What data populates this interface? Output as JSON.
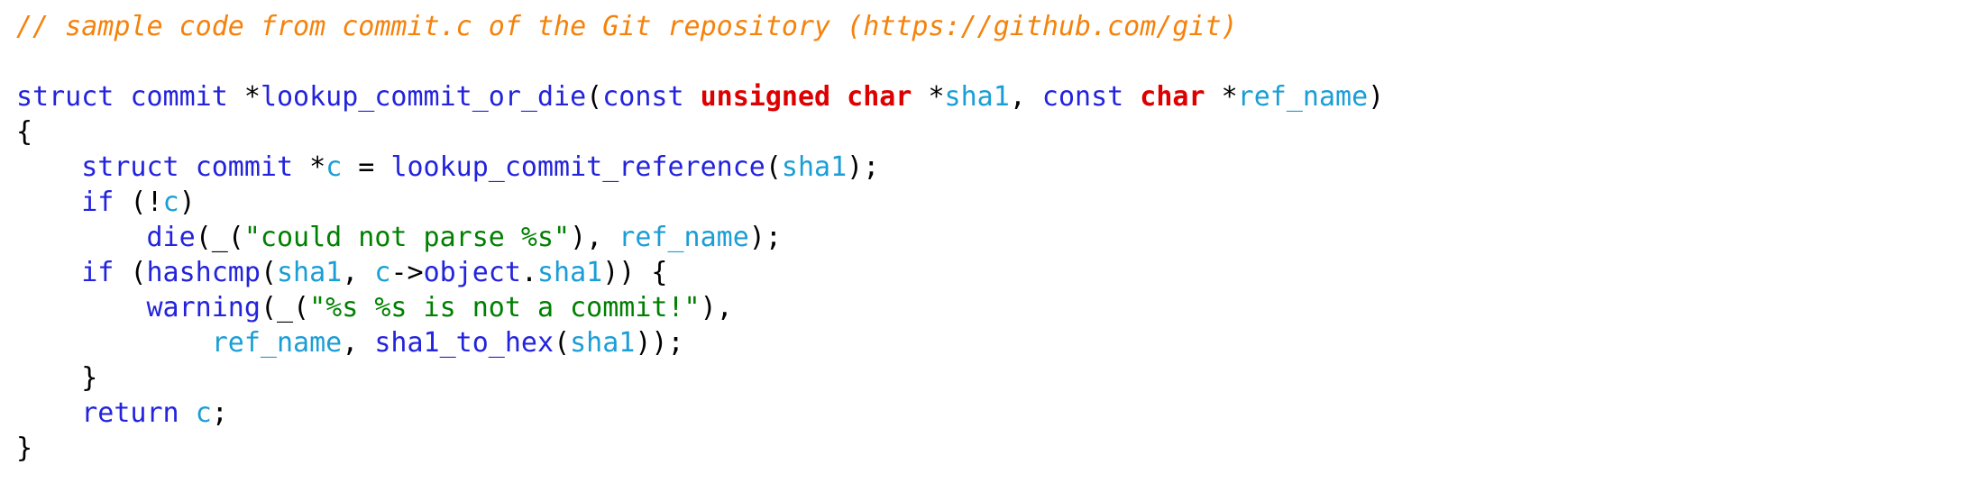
{
  "editor": {
    "language": "c",
    "background": "#ffffff",
    "font_size_px": 30,
    "colors": {
      "comment": "#f5820b",
      "keyword": "#2323dd",
      "function": "#2323dd",
      "type": "#dd0000",
      "variable": "#1a9ed6",
      "string": "#008000",
      "punctuation": "#000000"
    }
  },
  "code": {
    "lines": [
      {
        "id": "line-1-comment",
        "tokens": [
          {
            "text": "// sample code from commit.c of the Git repository (https://github.com/git)",
            "kind": "comment"
          }
        ]
      },
      {
        "id": "line-2-blank",
        "tokens": [
          {
            "text": " ",
            "kind": "plain"
          }
        ]
      },
      {
        "id": "line-3-signature",
        "tokens": [
          {
            "text": "struct",
            "kind": "keyword"
          },
          {
            "text": " ",
            "kind": "plain"
          },
          {
            "text": "commit",
            "kind": "keyword"
          },
          {
            "text": " *",
            "kind": "punctuation"
          },
          {
            "text": "lookup_commit_or_die",
            "kind": "function"
          },
          {
            "text": "(",
            "kind": "punctuation"
          },
          {
            "text": "const",
            "kind": "keyword"
          },
          {
            "text": " ",
            "kind": "plain"
          },
          {
            "text": "unsigned char",
            "kind": "type"
          },
          {
            "text": " *",
            "kind": "punctuation"
          },
          {
            "text": "sha1",
            "kind": "variable"
          },
          {
            "text": ", ",
            "kind": "punctuation"
          },
          {
            "text": "const",
            "kind": "keyword"
          },
          {
            "text": " ",
            "kind": "plain"
          },
          {
            "text": "char",
            "kind": "type"
          },
          {
            "text": " *",
            "kind": "punctuation"
          },
          {
            "text": "ref_name",
            "kind": "variable"
          },
          {
            "text": ")",
            "kind": "punctuation"
          }
        ]
      },
      {
        "id": "line-4-open-brace",
        "tokens": [
          {
            "text": "{",
            "kind": "punctuation"
          }
        ]
      },
      {
        "id": "line-5-decl",
        "tokens": [
          {
            "text": "    ",
            "kind": "plain"
          },
          {
            "text": "struct",
            "kind": "keyword"
          },
          {
            "text": " ",
            "kind": "plain"
          },
          {
            "text": "commit",
            "kind": "keyword"
          },
          {
            "text": " *",
            "kind": "punctuation"
          },
          {
            "text": "c",
            "kind": "variable"
          },
          {
            "text": " = ",
            "kind": "punctuation"
          },
          {
            "text": "lookup_commit_reference",
            "kind": "function"
          },
          {
            "text": "(",
            "kind": "punctuation"
          },
          {
            "text": "sha1",
            "kind": "variable"
          },
          {
            "text": ");",
            "kind": "punctuation"
          }
        ]
      },
      {
        "id": "line-6-if-not-c",
        "tokens": [
          {
            "text": "    ",
            "kind": "plain"
          },
          {
            "text": "if",
            "kind": "keyword"
          },
          {
            "text": " (!",
            "kind": "punctuation"
          },
          {
            "text": "c",
            "kind": "variable"
          },
          {
            "text": ")",
            "kind": "punctuation"
          }
        ]
      },
      {
        "id": "line-7-die",
        "tokens": [
          {
            "text": "        ",
            "kind": "plain"
          },
          {
            "text": "die",
            "kind": "function"
          },
          {
            "text": "(_(",
            "kind": "punctuation"
          },
          {
            "text": "\"could not parse %s\"",
            "kind": "string"
          },
          {
            "text": "), ",
            "kind": "punctuation"
          },
          {
            "text": "ref_name",
            "kind": "variable"
          },
          {
            "text": ");",
            "kind": "punctuation"
          }
        ]
      },
      {
        "id": "line-8-if-hashcmp",
        "tokens": [
          {
            "text": "    ",
            "kind": "plain"
          },
          {
            "text": "if",
            "kind": "keyword"
          },
          {
            "text": " (",
            "kind": "punctuation"
          },
          {
            "text": "hashcmp",
            "kind": "function"
          },
          {
            "text": "(",
            "kind": "punctuation"
          },
          {
            "text": "sha1",
            "kind": "variable"
          },
          {
            "text": ", ",
            "kind": "punctuation"
          },
          {
            "text": "c",
            "kind": "variable"
          },
          {
            "text": "->",
            "kind": "punctuation"
          },
          {
            "text": "object",
            "kind": "function"
          },
          {
            "text": ".",
            "kind": "punctuation"
          },
          {
            "text": "sha1",
            "kind": "variable"
          },
          {
            "text": ")) {",
            "kind": "punctuation"
          }
        ]
      },
      {
        "id": "line-9-warning",
        "tokens": [
          {
            "text": "        ",
            "kind": "plain"
          },
          {
            "text": "warning",
            "kind": "function"
          },
          {
            "text": "(_(",
            "kind": "punctuation"
          },
          {
            "text": "\"%s %s is not a commit!\"",
            "kind": "string"
          },
          {
            "text": "),",
            "kind": "punctuation"
          }
        ]
      },
      {
        "id": "line-10-warning-args",
        "tokens": [
          {
            "text": "            ",
            "kind": "plain"
          },
          {
            "text": "ref_name",
            "kind": "variable"
          },
          {
            "text": ", ",
            "kind": "punctuation"
          },
          {
            "text": "sha1_to_hex",
            "kind": "function"
          },
          {
            "text": "(",
            "kind": "punctuation"
          },
          {
            "text": "sha1",
            "kind": "variable"
          },
          {
            "text": "));",
            "kind": "punctuation"
          }
        ]
      },
      {
        "id": "line-11-close-inner",
        "tokens": [
          {
            "text": "    ",
            "kind": "plain"
          },
          {
            "text": "}",
            "kind": "punctuation"
          }
        ]
      },
      {
        "id": "line-12-return",
        "tokens": [
          {
            "text": "    ",
            "kind": "plain"
          },
          {
            "text": "return",
            "kind": "keyword"
          },
          {
            "text": " ",
            "kind": "plain"
          },
          {
            "text": "c",
            "kind": "variable"
          },
          {
            "text": ";",
            "kind": "punctuation"
          }
        ]
      },
      {
        "id": "line-13-close-outer",
        "tokens": [
          {
            "text": "}",
            "kind": "punctuation"
          }
        ]
      }
    ]
  }
}
